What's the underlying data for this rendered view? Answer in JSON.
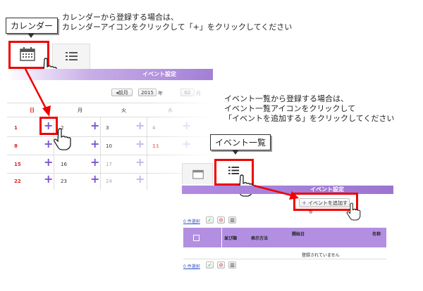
{
  "callouts": {
    "calendar": "カレンダー",
    "list": "イベント一覧"
  },
  "notes": {
    "calendar_line1": "カレンダーから登録する場合は、",
    "calendar_line2": "カレンダーアイコンをクリックして「+」をクリックしてください",
    "list_line1": "イベント一覧から登録する場合は、",
    "list_line2": "イベント一覧アイコンをクリックして",
    "list_line3": "「イベントを追加する」をクリックしてください"
  },
  "calendar": {
    "header": "イベント設定",
    "prev_button": "◂前月",
    "year_value": "2015",
    "year_unit": "年",
    "month_value": "02",
    "month_unit": "月",
    "weekdays": [
      "日",
      "月",
      "火",
      "水"
    ],
    "rows": [
      [
        "1",
        "2",
        "3",
        "4"
      ],
      [
        "8",
        "9",
        "10",
        "11"
      ],
      [
        "15",
        "16",
        "17",
        "18"
      ],
      [
        "22",
        "23",
        "24",
        "25"
      ]
    ],
    "plus": "+"
  },
  "list": {
    "header": "イベント設定",
    "add_button": "イベントを追加する",
    "selected_top": "0 件選択",
    "selected_bottom": "0 件選択",
    "col_sort": "並び順",
    "col_display": "表示方法",
    "col_start": "開始日",
    "col_name": "名称",
    "empty": "登録されていません"
  },
  "colors": {
    "accent": "#7a55d0",
    "highlight": "#ee0000",
    "header_purple": "#a37fd6"
  }
}
